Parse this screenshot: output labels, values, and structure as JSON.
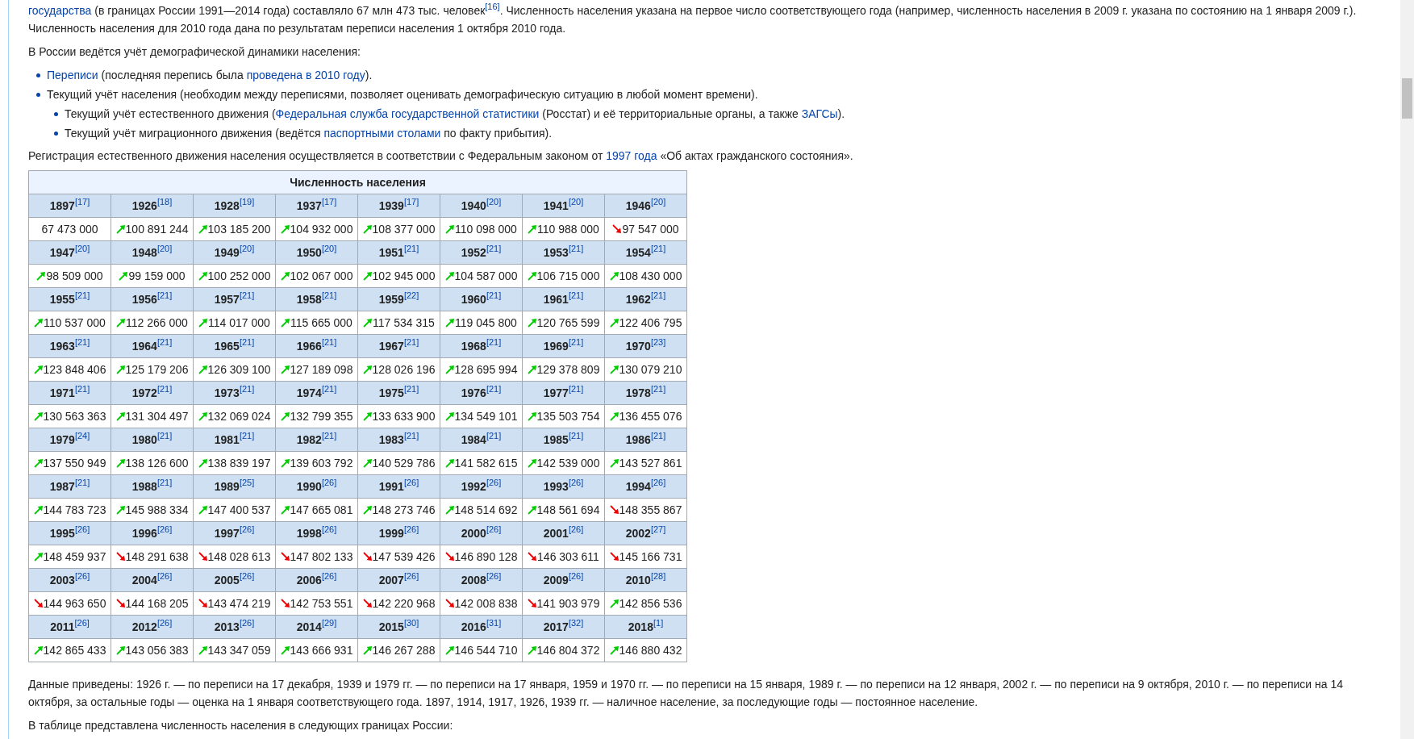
{
  "intro": [
    {
      "kind": "link",
      "text": "государства"
    },
    {
      "kind": "text",
      "text": " (в границах России 1991—2014 года) составляло 67 млн 473 тыс. человек"
    },
    {
      "kind": "ref",
      "text": "[16]"
    },
    {
      "kind": "text",
      "text": ". Численность населения указана на первое число соответствующего года (например, численность населения в 2009 г. указана по состоянию на 1 января 2009 г.). Численность населения для 2010 года дана по результатам переписи населения 1 октября 2010 года."
    }
  ],
  "lead": "В России ведётся учёт демографической динамики населения:",
  "list": [
    {
      "segments": [
        {
          "kind": "link",
          "text": "Переписи"
        },
        {
          "kind": "text",
          "text": " (последняя перепись была "
        },
        {
          "kind": "link",
          "text": "проведена в 2010 году"
        },
        {
          "kind": "text",
          "text": ")."
        }
      ]
    },
    {
      "segments": [
        {
          "kind": "text",
          "text": "Текущий учёт населения (необходим между переписями, позволяет оценивать демографическую ситуацию в любой момент времени)."
        }
      ],
      "children": [
        {
          "segments": [
            {
              "kind": "text",
              "text": "Текущий учёт естественного движения ("
            },
            {
              "kind": "link",
              "text": "Федеральная служба государственной статистики"
            },
            {
              "kind": "text",
              "text": " (Росстат) и её территориальные органы, а также "
            },
            {
              "kind": "link",
              "text": "ЗАГСы"
            },
            {
              "kind": "text",
              "text": ")."
            }
          ]
        },
        {
          "segments": [
            {
              "kind": "text",
              "text": "Текущий учёт миграционного движения (ведётся "
            },
            {
              "kind": "link",
              "text": "паспортными столами"
            },
            {
              "kind": "text",
              "text": " по факту прибытия)."
            }
          ]
        }
      ]
    }
  ],
  "registration": [
    {
      "kind": "text",
      "text": "Регистрация естественного движения населения осуществляется в соответствии с Федеральным законом от "
    },
    {
      "kind": "link",
      "text": "1997 года"
    },
    {
      "kind": "text",
      "text": " «Об актах гражданского состояния»."
    }
  ],
  "table": {
    "caption": "Численность населения",
    "groups": [
      {
        "years": [
          {
            "year": "1897",
            "ref": "[17]"
          },
          {
            "year": "1926",
            "ref": "[18]"
          },
          {
            "year": "1928",
            "ref": "[19]"
          },
          {
            "year": "1937",
            "ref": "[17]"
          },
          {
            "year": "1939",
            "ref": "[17]"
          },
          {
            "year": "1940",
            "ref": "[20]"
          },
          {
            "year": "1941",
            "ref": "[20]"
          },
          {
            "year": "1946",
            "ref": "[20]"
          }
        ],
        "values": [
          {
            "value": "67 473 000",
            "kind": "plain"
          },
          {
            "value": "100 891 244",
            "kind": "up"
          },
          {
            "value": "103 185 200",
            "kind": "up"
          },
          {
            "value": "104 932 000",
            "kind": "up"
          },
          {
            "value": "108 377 000",
            "kind": "up"
          },
          {
            "value": "110 098 000",
            "kind": "up"
          },
          {
            "value": "110 988 000",
            "kind": "up"
          },
          {
            "value": "97 547 000",
            "kind": "down"
          }
        ]
      },
      {
        "years": [
          {
            "year": "1947",
            "ref": "[20]"
          },
          {
            "year": "1948",
            "ref": "[20]"
          },
          {
            "year": "1949",
            "ref": "[20]"
          },
          {
            "year": "1950",
            "ref": "[20]"
          },
          {
            "year": "1951",
            "ref": "[21]"
          },
          {
            "year": "1952",
            "ref": "[21]"
          },
          {
            "year": "1953",
            "ref": "[21]"
          },
          {
            "year": "1954",
            "ref": "[21]"
          }
        ],
        "values": [
          {
            "value": "98 509 000",
            "kind": "up"
          },
          {
            "value": "99 159 000",
            "kind": "up"
          },
          {
            "value": "100 252 000",
            "kind": "up"
          },
          {
            "value": "102 067 000",
            "kind": "up"
          },
          {
            "value": "102 945 000",
            "kind": "up"
          },
          {
            "value": "104 587 000",
            "kind": "up"
          },
          {
            "value": "106 715 000",
            "kind": "up"
          },
          {
            "value": "108 430 000",
            "kind": "up"
          }
        ]
      },
      {
        "years": [
          {
            "year": "1955",
            "ref": "[21]"
          },
          {
            "year": "1956",
            "ref": "[21]"
          },
          {
            "year": "1957",
            "ref": "[21]"
          },
          {
            "year": "1958",
            "ref": "[21]"
          },
          {
            "year": "1959",
            "ref": "[22]"
          },
          {
            "year": "1960",
            "ref": "[21]"
          },
          {
            "year": "1961",
            "ref": "[21]"
          },
          {
            "year": "1962",
            "ref": "[21]"
          }
        ],
        "values": [
          {
            "value": "110 537 000",
            "kind": "up"
          },
          {
            "value": "112 266 000",
            "kind": "up"
          },
          {
            "value": "114 017 000",
            "kind": "up"
          },
          {
            "value": "115 665 000",
            "kind": "up"
          },
          {
            "value": "117 534 315",
            "kind": "up"
          },
          {
            "value": "119 045 800",
            "kind": "up"
          },
          {
            "value": "120 765 599",
            "kind": "up"
          },
          {
            "value": "122 406 795",
            "kind": "up"
          }
        ]
      },
      {
        "years": [
          {
            "year": "1963",
            "ref": "[21]"
          },
          {
            "year": "1964",
            "ref": "[21]"
          },
          {
            "year": "1965",
            "ref": "[21]"
          },
          {
            "year": "1966",
            "ref": "[21]"
          },
          {
            "year": "1967",
            "ref": "[21]"
          },
          {
            "year": "1968",
            "ref": "[21]"
          },
          {
            "year": "1969",
            "ref": "[21]"
          },
          {
            "year": "1970",
            "ref": "[23]"
          }
        ],
        "values": [
          {
            "value": "123 848 406",
            "kind": "up"
          },
          {
            "value": "125 179 206",
            "kind": "up"
          },
          {
            "value": "126 309 100",
            "kind": "up"
          },
          {
            "value": "127 189 098",
            "kind": "up"
          },
          {
            "value": "128 026 196",
            "kind": "up"
          },
          {
            "value": "128 695 994",
            "kind": "up"
          },
          {
            "value": "129 378 809",
            "kind": "up"
          },
          {
            "value": "130 079 210",
            "kind": "up"
          }
        ]
      },
      {
        "years": [
          {
            "year": "1971",
            "ref": "[21]"
          },
          {
            "year": "1972",
            "ref": "[21]"
          },
          {
            "year": "1973",
            "ref": "[21]"
          },
          {
            "year": "1974",
            "ref": "[21]"
          },
          {
            "year": "1975",
            "ref": "[21]"
          },
          {
            "year": "1976",
            "ref": "[21]"
          },
          {
            "year": "1977",
            "ref": "[21]"
          },
          {
            "year": "1978",
            "ref": "[21]"
          }
        ],
        "values": [
          {
            "value": "130 563 363",
            "kind": "up"
          },
          {
            "value": "131 304 497",
            "kind": "up"
          },
          {
            "value": "132 069 024",
            "kind": "up"
          },
          {
            "value": "132 799 355",
            "kind": "up"
          },
          {
            "value": "133 633 900",
            "kind": "up"
          },
          {
            "value": "134 549 101",
            "kind": "up"
          },
          {
            "value": "135 503 754",
            "kind": "up"
          },
          {
            "value": "136 455 076",
            "kind": "up"
          }
        ]
      },
      {
        "years": [
          {
            "year": "1979",
            "ref": "[24]"
          },
          {
            "year": "1980",
            "ref": "[21]"
          },
          {
            "year": "1981",
            "ref": "[21]"
          },
          {
            "year": "1982",
            "ref": "[21]"
          },
          {
            "year": "1983",
            "ref": "[21]"
          },
          {
            "year": "1984",
            "ref": "[21]"
          },
          {
            "year": "1985",
            "ref": "[21]"
          },
          {
            "year": "1986",
            "ref": "[21]"
          }
        ],
        "values": [
          {
            "value": "137 550 949",
            "kind": "up"
          },
          {
            "value": "138 126 600",
            "kind": "up"
          },
          {
            "value": "138 839 197",
            "kind": "up"
          },
          {
            "value": "139 603 792",
            "kind": "up"
          },
          {
            "value": "140 529 786",
            "kind": "up"
          },
          {
            "value": "141 582 615",
            "kind": "up"
          },
          {
            "value": "142 539 000",
            "kind": "up"
          },
          {
            "value": "143 527 861",
            "kind": "up"
          }
        ]
      },
      {
        "years": [
          {
            "year": "1987",
            "ref": "[21]"
          },
          {
            "year": "1988",
            "ref": "[21]"
          },
          {
            "year": "1989",
            "ref": "[25]"
          },
          {
            "year": "1990",
            "ref": "[26]"
          },
          {
            "year": "1991",
            "ref": "[26]"
          },
          {
            "year": "1992",
            "ref": "[26]"
          },
          {
            "year": "1993",
            "ref": "[26]"
          },
          {
            "year": "1994",
            "ref": "[26]"
          }
        ],
        "values": [
          {
            "value": "144 783 723",
            "kind": "up"
          },
          {
            "value": "145 988 334",
            "kind": "up"
          },
          {
            "value": "147 400 537",
            "kind": "up"
          },
          {
            "value": "147 665 081",
            "kind": "up"
          },
          {
            "value": "148 273 746",
            "kind": "up"
          },
          {
            "value": "148 514 692",
            "kind": "up"
          },
          {
            "value": "148 561 694",
            "kind": "up"
          },
          {
            "value": "148 355 867",
            "kind": "down"
          }
        ]
      },
      {
        "years": [
          {
            "year": "1995",
            "ref": "[26]"
          },
          {
            "year": "1996",
            "ref": "[26]"
          },
          {
            "year": "1997",
            "ref": "[26]"
          },
          {
            "year": "1998",
            "ref": "[26]"
          },
          {
            "year": "1999",
            "ref": "[26]"
          },
          {
            "year": "2000",
            "ref": "[26]"
          },
          {
            "year": "2001",
            "ref": "[26]"
          },
          {
            "year": "2002",
            "ref": "[27]"
          }
        ],
        "values": [
          {
            "value": "148 459 937",
            "kind": "up"
          },
          {
            "value": "148 291 638",
            "kind": "down"
          },
          {
            "value": "148 028 613",
            "kind": "down"
          },
          {
            "value": "147 802 133",
            "kind": "down"
          },
          {
            "value": "147 539 426",
            "kind": "down"
          },
          {
            "value": "146 890 128",
            "kind": "down"
          },
          {
            "value": "146 303 611",
            "kind": "down"
          },
          {
            "value": "145 166 731",
            "kind": "down"
          }
        ]
      },
      {
        "years": [
          {
            "year": "2003",
            "ref": "[26]"
          },
          {
            "year": "2004",
            "ref": "[26]"
          },
          {
            "year": "2005",
            "ref": "[26]"
          },
          {
            "year": "2006",
            "ref": "[26]"
          },
          {
            "year": "2007",
            "ref": "[26]"
          },
          {
            "year": "2008",
            "ref": "[26]"
          },
          {
            "year": "2009",
            "ref": "[26]"
          },
          {
            "year": "2010",
            "ref": "[28]"
          }
        ],
        "values": [
          {
            "value": "144 963 650",
            "kind": "down"
          },
          {
            "value": "144 168 205",
            "kind": "down"
          },
          {
            "value": "143 474 219",
            "kind": "down"
          },
          {
            "value": "142 753 551",
            "kind": "down"
          },
          {
            "value": "142 220 968",
            "kind": "down"
          },
          {
            "value": "142 008 838",
            "kind": "down"
          },
          {
            "value": "141 903 979",
            "kind": "down"
          },
          {
            "value": "142 856 536",
            "kind": "up"
          }
        ]
      },
      {
        "years": [
          {
            "year": "2011",
            "ref": "[26]"
          },
          {
            "year": "2012",
            "ref": "[26]"
          },
          {
            "year": "2013",
            "ref": "[26]"
          },
          {
            "year": "2014",
            "ref": "[29]"
          },
          {
            "year": "2015",
            "ref": "[30]"
          },
          {
            "year": "2016",
            "ref": "[31]"
          },
          {
            "year": "2017",
            "ref": "[32]"
          },
          {
            "year": "2018",
            "ref": "[1]"
          }
        ],
        "values": [
          {
            "value": "142 865 433",
            "kind": "up"
          },
          {
            "value": "143 056 383",
            "kind": "up"
          },
          {
            "value": "143 347 059",
            "kind": "up"
          },
          {
            "value": "143 666 931",
            "kind": "up"
          },
          {
            "value": "146 267 288",
            "kind": "up"
          },
          {
            "value": "146 544 710",
            "kind": "up"
          },
          {
            "value": "146 804 372",
            "kind": "up"
          },
          {
            "value": "146 880 432",
            "kind": "up"
          }
        ]
      }
    ]
  },
  "notes": "Данные приведены: 1926 г. — по переписи на 17 декабря, 1939 и 1979 гг. — по переписи на 17 января, 1959 и 1970 гг. — по переписи на 15 января, 1989 г. — по переписи на 12 января, 2002 г. — по переписи на 9 октября, 2010 г. — по переписи на 14 октября, за остальные годы — оценка на 1 января соответствующего года. 1897, 1914, 1917, 1926, 1939 гг. — наличное население, за последующие годы — постоянное население.",
  "borders": "В таблице представлена численность населения в следующих границах России:"
}
